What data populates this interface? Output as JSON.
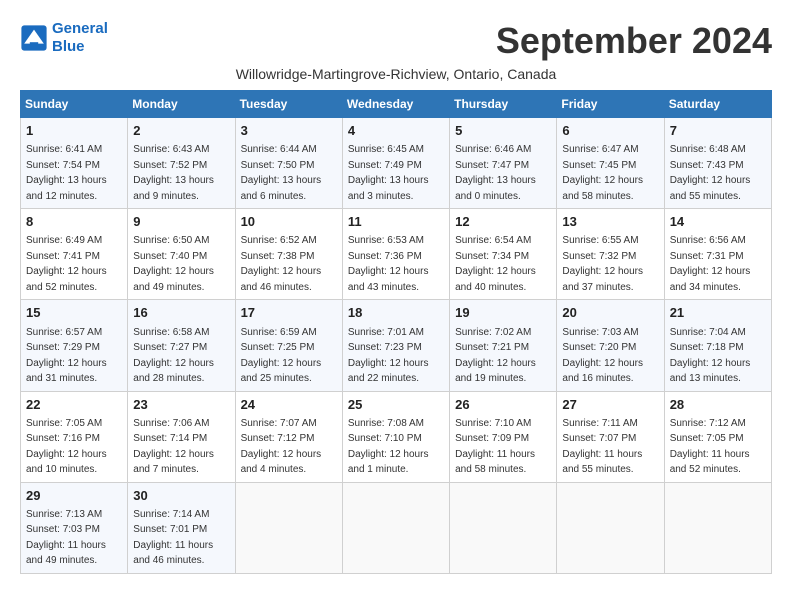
{
  "header": {
    "logo_line1": "General",
    "logo_line2": "Blue",
    "month_year": "September 2024",
    "subtitle": "Willowridge-Martingrove-Richview, Ontario, Canada"
  },
  "weekdays": [
    "Sunday",
    "Monday",
    "Tuesday",
    "Wednesday",
    "Thursday",
    "Friday",
    "Saturday"
  ],
  "weeks": [
    [
      {
        "day": "1",
        "sunrise": "Sunrise: 6:41 AM",
        "sunset": "Sunset: 7:54 PM",
        "daylight": "Daylight: 13 hours and 12 minutes."
      },
      {
        "day": "2",
        "sunrise": "Sunrise: 6:43 AM",
        "sunset": "Sunset: 7:52 PM",
        "daylight": "Daylight: 13 hours and 9 minutes."
      },
      {
        "day": "3",
        "sunrise": "Sunrise: 6:44 AM",
        "sunset": "Sunset: 7:50 PM",
        "daylight": "Daylight: 13 hours and 6 minutes."
      },
      {
        "day": "4",
        "sunrise": "Sunrise: 6:45 AM",
        "sunset": "Sunset: 7:49 PM",
        "daylight": "Daylight: 13 hours and 3 minutes."
      },
      {
        "day": "5",
        "sunrise": "Sunrise: 6:46 AM",
        "sunset": "Sunset: 7:47 PM",
        "daylight": "Daylight: 13 hours and 0 minutes."
      },
      {
        "day": "6",
        "sunrise": "Sunrise: 6:47 AM",
        "sunset": "Sunset: 7:45 PM",
        "daylight": "Daylight: 12 hours and 58 minutes."
      },
      {
        "day": "7",
        "sunrise": "Sunrise: 6:48 AM",
        "sunset": "Sunset: 7:43 PM",
        "daylight": "Daylight: 12 hours and 55 minutes."
      }
    ],
    [
      {
        "day": "8",
        "sunrise": "Sunrise: 6:49 AM",
        "sunset": "Sunset: 7:41 PM",
        "daylight": "Daylight: 12 hours and 52 minutes."
      },
      {
        "day": "9",
        "sunrise": "Sunrise: 6:50 AM",
        "sunset": "Sunset: 7:40 PM",
        "daylight": "Daylight: 12 hours and 49 minutes."
      },
      {
        "day": "10",
        "sunrise": "Sunrise: 6:52 AM",
        "sunset": "Sunset: 7:38 PM",
        "daylight": "Daylight: 12 hours and 46 minutes."
      },
      {
        "day": "11",
        "sunrise": "Sunrise: 6:53 AM",
        "sunset": "Sunset: 7:36 PM",
        "daylight": "Daylight: 12 hours and 43 minutes."
      },
      {
        "day": "12",
        "sunrise": "Sunrise: 6:54 AM",
        "sunset": "Sunset: 7:34 PM",
        "daylight": "Daylight: 12 hours and 40 minutes."
      },
      {
        "day": "13",
        "sunrise": "Sunrise: 6:55 AM",
        "sunset": "Sunset: 7:32 PM",
        "daylight": "Daylight: 12 hours and 37 minutes."
      },
      {
        "day": "14",
        "sunrise": "Sunrise: 6:56 AM",
        "sunset": "Sunset: 7:31 PM",
        "daylight": "Daylight: 12 hours and 34 minutes."
      }
    ],
    [
      {
        "day": "15",
        "sunrise": "Sunrise: 6:57 AM",
        "sunset": "Sunset: 7:29 PM",
        "daylight": "Daylight: 12 hours and 31 minutes."
      },
      {
        "day": "16",
        "sunrise": "Sunrise: 6:58 AM",
        "sunset": "Sunset: 7:27 PM",
        "daylight": "Daylight: 12 hours and 28 minutes."
      },
      {
        "day": "17",
        "sunrise": "Sunrise: 6:59 AM",
        "sunset": "Sunset: 7:25 PM",
        "daylight": "Daylight: 12 hours and 25 minutes."
      },
      {
        "day": "18",
        "sunrise": "Sunrise: 7:01 AM",
        "sunset": "Sunset: 7:23 PM",
        "daylight": "Daylight: 12 hours and 22 minutes."
      },
      {
        "day": "19",
        "sunrise": "Sunrise: 7:02 AM",
        "sunset": "Sunset: 7:21 PM",
        "daylight": "Daylight: 12 hours and 19 minutes."
      },
      {
        "day": "20",
        "sunrise": "Sunrise: 7:03 AM",
        "sunset": "Sunset: 7:20 PM",
        "daylight": "Daylight: 12 hours and 16 minutes."
      },
      {
        "day": "21",
        "sunrise": "Sunrise: 7:04 AM",
        "sunset": "Sunset: 7:18 PM",
        "daylight": "Daylight: 12 hours and 13 minutes."
      }
    ],
    [
      {
        "day": "22",
        "sunrise": "Sunrise: 7:05 AM",
        "sunset": "Sunset: 7:16 PM",
        "daylight": "Daylight: 12 hours and 10 minutes."
      },
      {
        "day": "23",
        "sunrise": "Sunrise: 7:06 AM",
        "sunset": "Sunset: 7:14 PM",
        "daylight": "Daylight: 12 hours and 7 minutes."
      },
      {
        "day": "24",
        "sunrise": "Sunrise: 7:07 AM",
        "sunset": "Sunset: 7:12 PM",
        "daylight": "Daylight: 12 hours and 4 minutes."
      },
      {
        "day": "25",
        "sunrise": "Sunrise: 7:08 AM",
        "sunset": "Sunset: 7:10 PM",
        "daylight": "Daylight: 12 hours and 1 minute."
      },
      {
        "day": "26",
        "sunrise": "Sunrise: 7:10 AM",
        "sunset": "Sunset: 7:09 PM",
        "daylight": "Daylight: 11 hours and 58 minutes."
      },
      {
        "day": "27",
        "sunrise": "Sunrise: 7:11 AM",
        "sunset": "Sunset: 7:07 PM",
        "daylight": "Daylight: 11 hours and 55 minutes."
      },
      {
        "day": "28",
        "sunrise": "Sunrise: 7:12 AM",
        "sunset": "Sunset: 7:05 PM",
        "daylight": "Daylight: 11 hours and 52 minutes."
      }
    ],
    [
      {
        "day": "29",
        "sunrise": "Sunrise: 7:13 AM",
        "sunset": "Sunset: 7:03 PM",
        "daylight": "Daylight: 11 hours and 49 minutes."
      },
      {
        "day": "30",
        "sunrise": "Sunrise: 7:14 AM",
        "sunset": "Sunset: 7:01 PM",
        "daylight": "Daylight: 11 hours and 46 minutes."
      },
      {
        "day": "",
        "sunrise": "",
        "sunset": "",
        "daylight": ""
      },
      {
        "day": "",
        "sunrise": "",
        "sunset": "",
        "daylight": ""
      },
      {
        "day": "",
        "sunrise": "",
        "sunset": "",
        "daylight": ""
      },
      {
        "day": "",
        "sunrise": "",
        "sunset": "",
        "daylight": ""
      },
      {
        "day": "",
        "sunrise": "",
        "sunset": "",
        "daylight": ""
      }
    ]
  ]
}
